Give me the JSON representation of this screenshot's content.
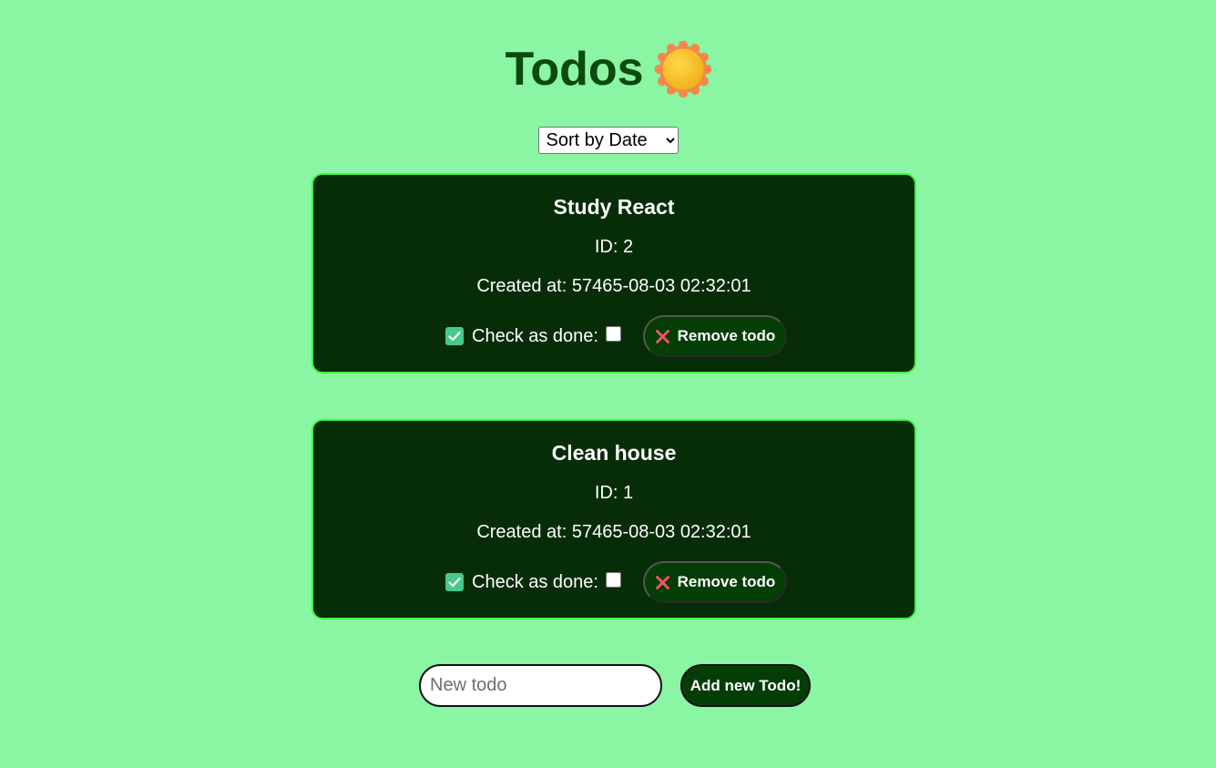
{
  "header": {
    "title": "Todos",
    "icon": "sun-icon"
  },
  "sort": {
    "selected": "Sort by Date"
  },
  "todos": [
    {
      "title": "Study React",
      "id_text": "ID: 2",
      "created_label": "Created at:",
      "created_value": "57465-08-03 02:32:01",
      "check_label": "Check as done:",
      "done": false,
      "remove_label": "Remove todo"
    },
    {
      "title": "Clean house",
      "id_text": "ID: 1",
      "created_label": "Created at:",
      "created_value": "57465-08-03 02:32:01",
      "check_label": "Check as done:",
      "done": false,
      "remove_label": "Remove todo"
    }
  ],
  "new_todo": {
    "placeholder": "New todo",
    "value": "",
    "add_label": "Add new Todo!"
  },
  "colors": {
    "background": "#8af5a3",
    "card": "#062d07",
    "card_border": "#3ef53e",
    "title": "#0b4a0e",
    "check_emoji": "#46c98a",
    "remove_x": "#f0506e"
  }
}
